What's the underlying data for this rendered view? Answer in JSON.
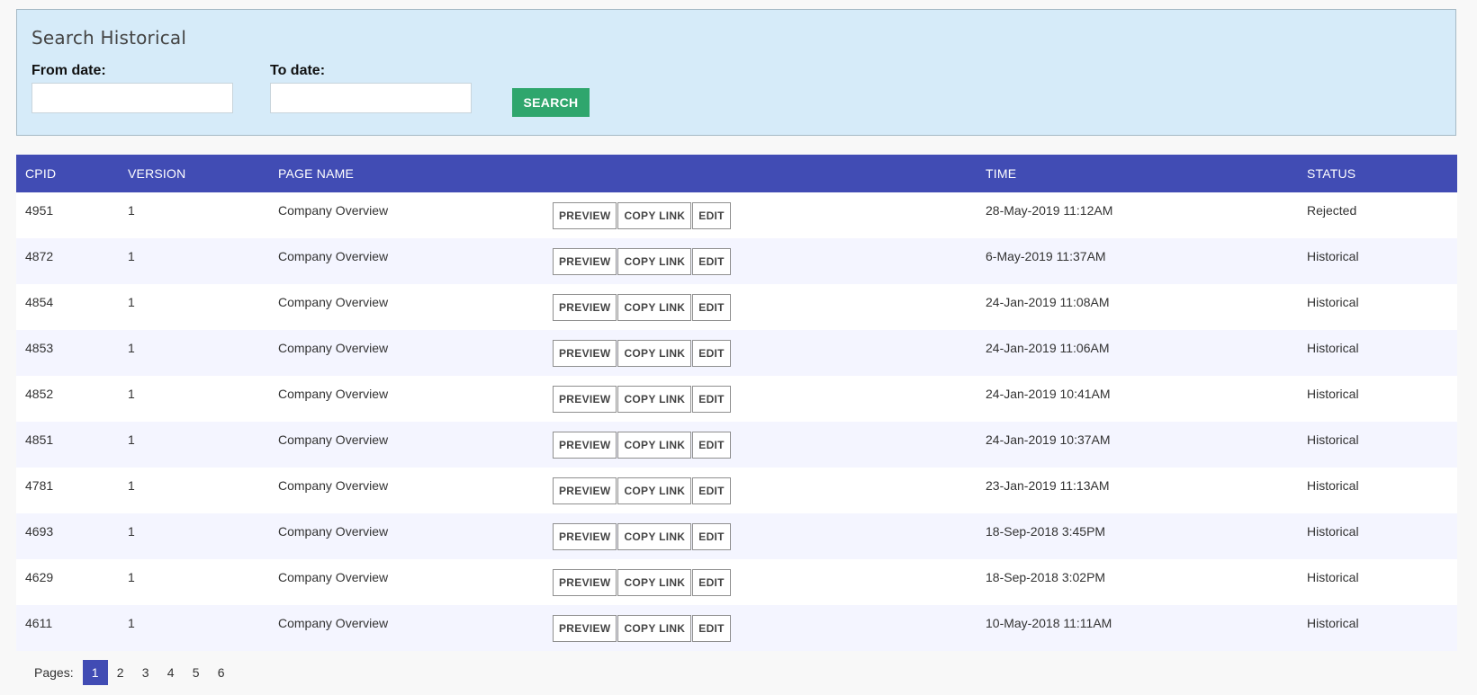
{
  "search": {
    "title": "Search Historical",
    "from_label": "From date:",
    "from_value": "",
    "to_label": "To date:",
    "to_value": "",
    "button_label": "SEARCH"
  },
  "table": {
    "headers": {
      "cpid": "CPID",
      "version": "VERSION",
      "page_name": "PAGE NAME",
      "actions": "",
      "time": "TIME",
      "status": "STATUS"
    },
    "action_labels": {
      "preview": "PREVIEW",
      "copy_link": "COPY LINK",
      "edit": "EDIT"
    },
    "rows": [
      {
        "cpid": "4951",
        "version": "1",
        "page_name": "Company Overview",
        "time": "28-May-2019 11:12AM",
        "status": "Rejected"
      },
      {
        "cpid": "4872",
        "version": "1",
        "page_name": "Company Overview",
        "time": "6-May-2019 11:37AM",
        "status": "Historical"
      },
      {
        "cpid": "4854",
        "version": "1",
        "page_name": "Company Overview",
        "time": "24-Jan-2019 11:08AM",
        "status": "Historical"
      },
      {
        "cpid": "4853",
        "version": "1",
        "page_name": "Company Overview",
        "time": "24-Jan-2019 11:06AM",
        "status": "Historical"
      },
      {
        "cpid": "4852",
        "version": "1",
        "page_name": "Company Overview",
        "time": "24-Jan-2019 10:41AM",
        "status": "Historical"
      },
      {
        "cpid": "4851",
        "version": "1",
        "page_name": "Company Overview",
        "time": "24-Jan-2019 10:37AM",
        "status": "Historical"
      },
      {
        "cpid": "4781",
        "version": "1",
        "page_name": "Company Overview",
        "time": "23-Jan-2019 11:13AM",
        "status": "Historical"
      },
      {
        "cpid": "4693",
        "version": "1",
        "page_name": "Company Overview",
        "time": "18-Sep-2018 3:45PM",
        "status": "Historical"
      },
      {
        "cpid": "4629",
        "version": "1",
        "page_name": "Company Overview",
        "time": "18-Sep-2018 3:02PM",
        "status": "Historical"
      },
      {
        "cpid": "4611",
        "version": "1",
        "page_name": "Company Overview",
        "time": "10-May-2018 11:11AM",
        "status": "Historical"
      }
    ]
  },
  "pagination": {
    "label": "Pages:",
    "current": "1",
    "pages": [
      "1",
      "2",
      "3",
      "4",
      "5",
      "6"
    ]
  },
  "colors": {
    "header_bg": "#414cb4",
    "search_panel_bg": "#d6ebf9",
    "search_button_bg": "#2fa66d",
    "alt_row_bg": "#f4f5ff"
  }
}
